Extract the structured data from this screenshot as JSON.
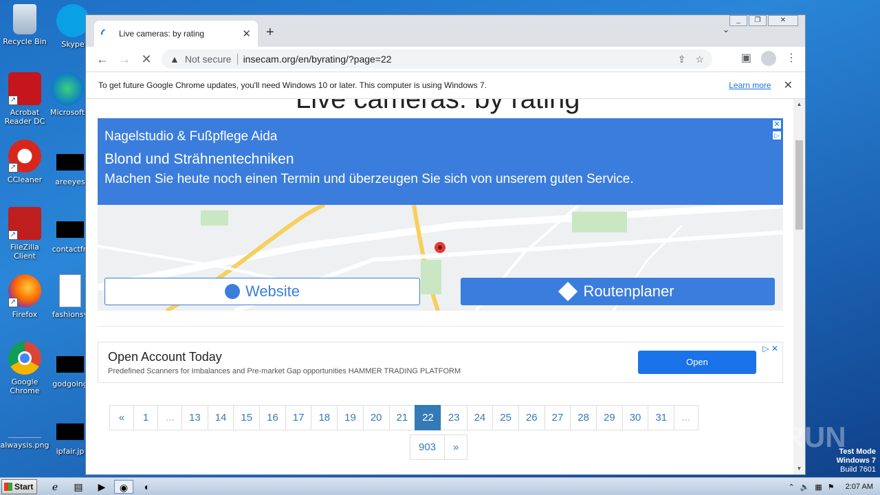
{
  "desktop": {
    "icons_left": [
      {
        "label": "Recycle Bin",
        "icon": "recycle-bin-icon"
      },
      {
        "label": "Acrobat Reader DC",
        "icon": "acrobat-icon"
      },
      {
        "label": "CCleaner",
        "icon": "ccleaner-icon"
      },
      {
        "label": "FileZilla Client",
        "icon": "filezilla-icon"
      },
      {
        "label": "Firefox",
        "icon": "firefox-icon"
      },
      {
        "label": "Google Chrome",
        "icon": "chrome-icon"
      },
      {
        "label": "alwaysis.png",
        "icon": "image-file-icon"
      }
    ],
    "icons_right": [
      {
        "label": "Skype",
        "icon": "skype-icon"
      },
      {
        "label": "Microsoft",
        "icon": "edge-icon"
      },
      {
        "label": "areeyes",
        "icon": "file-icon"
      },
      {
        "label": "contactfri",
        "icon": "file-icon"
      },
      {
        "label": "fashionsy",
        "icon": "word-icon"
      },
      {
        "label": "godgoing",
        "icon": "file-icon"
      },
      {
        "label": "ipfair.jp",
        "icon": "file-icon"
      }
    ]
  },
  "browser": {
    "tab_title": "Live cameras: by rating",
    "new_tab": "+",
    "not_secure": "Not secure",
    "url": "insecam.org/en/byrating/?page=22",
    "infobar_message": "To get future Google Chrome updates, you'll need Windows 10 or later. This computer is using Windows 7.",
    "infobar_link": "Learn more"
  },
  "page": {
    "title": "Live cameras: by rating",
    "ad1": {
      "line1": "Nagelstudio & Fußpflege Aida",
      "line2": "Blond und Strähnentechniken",
      "line3": "Machen Sie heute noch einen Termin und überzeugen Sie sich von unserem guten Service.",
      "website": "Website",
      "route": "Routenplaner"
    },
    "ad2": {
      "title": "Open Account Today",
      "desc": "Predefined Scanners for Imbalances and Pre-market Gap opportunities HAMMER TRADING PLATFORM",
      "button": "Open"
    },
    "pagination": [
      "«",
      "1",
      "...",
      "13",
      "14",
      "15",
      "16",
      "17",
      "18",
      "19",
      "20",
      "21",
      "22",
      "23",
      "24",
      "25",
      "26",
      "27",
      "28",
      "29",
      "30",
      "31",
      "..."
    ],
    "pagination_row2": [
      "903",
      "»"
    ],
    "active_page": "22"
  },
  "taskbar": {
    "start": "Start",
    "clock": "2:07 AM"
  },
  "watermark": {
    "line1": "Test Mode",
    "line2": "Windows 7",
    "line3": "Build 7601",
    "brand": "ANY RUN"
  }
}
